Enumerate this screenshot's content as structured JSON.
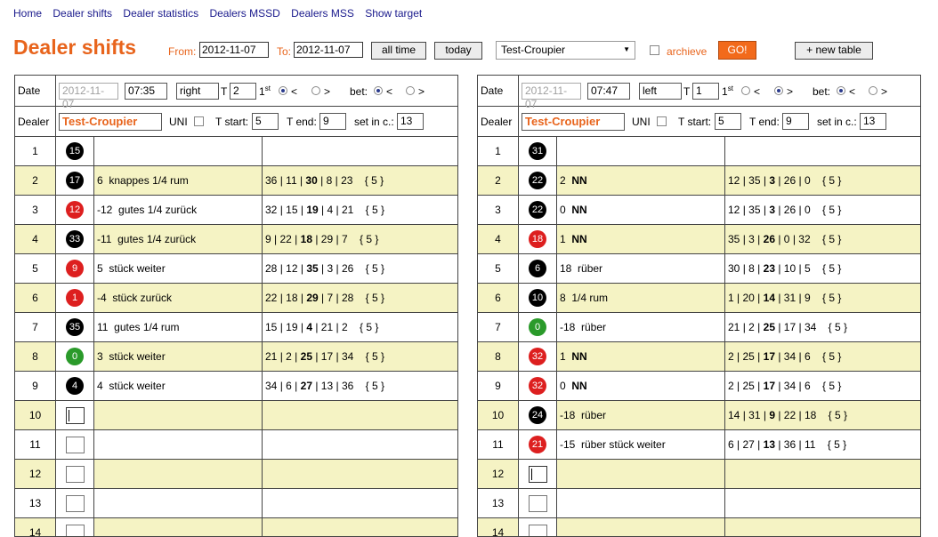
{
  "nav": [
    "Home",
    "Dealer shifts",
    "Dealer statistics",
    "Dealers MSSD",
    "Dealers MSS",
    "Show target"
  ],
  "page_title": "Dealer shifts",
  "filter": {
    "from_label": "From:",
    "from_value": "2012-11-07",
    "to_label": "To:",
    "to_value": "2012-11-07",
    "all_time": "all time",
    "today": "today",
    "croupier": "Test-Croupier",
    "archieve": "archieve",
    "go": "GO!",
    "new_table": "+ new table"
  },
  "labels": {
    "date": "Date",
    "dealer": "Dealer",
    "t": "T",
    "bet": "bet:",
    "uni": "UNI",
    "t_start": "T start:",
    "t_end": "T end:",
    "set_in_c": "set in c.:",
    "lt": "<",
    "gt": ">",
    "st_base": "1",
    "st_sup": "st"
  },
  "tables": [
    {
      "date": "2012-11-07",
      "time": "07:35",
      "side": "right",
      "t_value": "2",
      "st_choice": "<",
      "bet_choice": "<",
      "dealer": "Test-Croupier",
      "t_start": "5",
      "t_end": "9",
      "set_in": "13",
      "rows": [
        {
          "num": "1",
          "ball": "15",
          "color": "black",
          "move_n": "",
          "move_text": "",
          "seq": []
        },
        {
          "num": "2",
          "ball": "17",
          "color": "black",
          "move_n": "6",
          "move_text": "knappes 1/4 rum",
          "seq": [
            "36",
            "11",
            "30",
            "8",
            "23"
          ],
          "bold": 2,
          "tail": "{ 5 }"
        },
        {
          "num": "3",
          "ball": "12",
          "color": "red",
          "move_n": "-12",
          "move_text": "gutes 1/4 zurück",
          "seq": [
            "32",
            "15",
            "19",
            "4",
            "21"
          ],
          "bold": 2,
          "tail": "{ 5 }"
        },
        {
          "num": "4",
          "ball": "33",
          "color": "black",
          "move_n": "-11",
          "move_text": "gutes 1/4 zurück",
          "seq": [
            "9",
            "22",
            "18",
            "29",
            "7"
          ],
          "bold": 2,
          "tail": "{ 5 }"
        },
        {
          "num": "5",
          "ball": "9",
          "color": "red",
          "move_n": "5",
          "move_text": "stück weiter",
          "seq": [
            "28",
            "12",
            "35",
            "3",
            "26"
          ],
          "bold": 2,
          "tail": "{ 5 }"
        },
        {
          "num": "6",
          "ball": "1",
          "color": "red",
          "move_n": "-4",
          "move_text": "stück zurück",
          "seq": [
            "22",
            "18",
            "29",
            "7",
            "28"
          ],
          "bold": 2,
          "tail": "{ 5 }"
        },
        {
          "num": "7",
          "ball": "35",
          "color": "black",
          "move_n": "11",
          "move_text": "gutes 1/4 rum",
          "seq": [
            "15",
            "19",
            "4",
            "21",
            "2"
          ],
          "bold": 2,
          "tail": "{ 5 }"
        },
        {
          "num": "8",
          "ball": "0",
          "color": "green",
          "move_n": "3",
          "move_text": "stück weiter",
          "seq": [
            "21",
            "2",
            "25",
            "17",
            "34"
          ],
          "bold": 2,
          "tail": "{ 5 }"
        },
        {
          "num": "9",
          "ball": "4",
          "color": "black",
          "move_n": "4",
          "move_text": "stück weiter",
          "seq": [
            "34",
            "6",
            "27",
            "13",
            "36"
          ],
          "bold": 2,
          "tail": "{ 5 }"
        },
        {
          "num": "10",
          "ball": "",
          "color": "empty-focus",
          "move_n": "",
          "move_text": "",
          "seq": []
        },
        {
          "num": "11",
          "ball": "",
          "color": "empty",
          "move_n": "",
          "move_text": "",
          "seq": []
        },
        {
          "num": "12",
          "ball": "",
          "color": "empty",
          "move_n": "",
          "move_text": "",
          "seq": []
        },
        {
          "num": "13",
          "ball": "",
          "color": "empty",
          "move_n": "",
          "move_text": "",
          "seq": []
        },
        {
          "num": "14",
          "ball": "",
          "color": "empty",
          "move_n": "",
          "move_text": "",
          "seq": []
        }
      ]
    },
    {
      "date": "2012-11-07",
      "time": "07:47",
      "side": "left",
      "t_value": "1",
      "st_choice": ">",
      "bet_choice": "<",
      "dealer": "Test-Croupier",
      "t_start": "5",
      "t_end": "9",
      "set_in": "13",
      "rows": [
        {
          "num": "1",
          "ball": "31",
          "color": "black",
          "move_n": "",
          "move_text": "",
          "seq": []
        },
        {
          "num": "2",
          "ball": "22",
          "color": "black",
          "move_n": "2",
          "move_text": "NN",
          "move_bold": true,
          "seq": [
            "12",
            "35",
            "3",
            "26",
            "0"
          ],
          "bold": 2,
          "tail": "{ 5 }"
        },
        {
          "num": "3",
          "ball": "22",
          "color": "black",
          "move_n": "0",
          "move_text": "NN",
          "move_bold": true,
          "seq": [
            "12",
            "35",
            "3",
            "26",
            "0"
          ],
          "bold": 2,
          "tail": "{ 5 }"
        },
        {
          "num": "4",
          "ball": "18",
          "color": "red",
          "move_n": "1",
          "move_text": "NN",
          "move_bold": true,
          "seq": [
            "35",
            "3",
            "26",
            "0",
            "32"
          ],
          "bold": 2,
          "tail": "{ 5 }"
        },
        {
          "num": "5",
          "ball": "6",
          "color": "black",
          "move_n": "18",
          "move_text": "rüber",
          "seq": [
            "30",
            "8",
            "23",
            "10",
            "5"
          ],
          "bold": 2,
          "tail": "{ 5 }"
        },
        {
          "num": "6",
          "ball": "10",
          "color": "black",
          "move_n": "8",
          "move_text": "1/4 rum",
          "seq": [
            "1",
            "20",
            "14",
            "31",
            "9"
          ],
          "bold": 2,
          "tail": "{ 5 }"
        },
        {
          "num": "7",
          "ball": "0",
          "color": "green",
          "move_n": "-18",
          "move_text": "rüber",
          "seq": [
            "21",
            "2",
            "25",
            "17",
            "34"
          ],
          "bold": 2,
          "tail": "{ 5 }"
        },
        {
          "num": "8",
          "ball": "32",
          "color": "red",
          "move_n": "1",
          "move_text": "NN",
          "move_bold": true,
          "seq": [
            "2",
            "25",
            "17",
            "34",
            "6"
          ],
          "bold": 2,
          "tail": "{ 5 }"
        },
        {
          "num": "9",
          "ball": "32",
          "color": "red",
          "move_n": "0",
          "move_text": "NN",
          "move_bold": true,
          "seq": [
            "2",
            "25",
            "17",
            "34",
            "6"
          ],
          "bold": 2,
          "tail": "{ 5 }"
        },
        {
          "num": "10",
          "ball": "24",
          "color": "black",
          "move_n": "-18",
          "move_text": "rüber",
          "seq": [
            "14",
            "31",
            "9",
            "22",
            "18"
          ],
          "bold": 2,
          "tail": "{ 5 }"
        },
        {
          "num": "11",
          "ball": "21",
          "color": "red",
          "move_n": "-15",
          "move_text": "rüber stück weiter",
          "seq": [
            "6",
            "27",
            "13",
            "36",
            "11"
          ],
          "bold": 2,
          "tail": "{ 5 }"
        },
        {
          "num": "12",
          "ball": "",
          "color": "empty-focus",
          "move_n": "",
          "move_text": "",
          "seq": []
        },
        {
          "num": "13",
          "ball": "",
          "color": "empty",
          "move_n": "",
          "move_text": "",
          "seq": []
        },
        {
          "num": "14",
          "ball": "",
          "color": "empty",
          "move_n": "",
          "move_text": "",
          "seq": []
        }
      ]
    }
  ],
  "colors": {
    "accent": "#e8641c",
    "go_button": "#f26a1b",
    "row_highlight": "#f5f3c4",
    "ball_black": "#000000",
    "ball_red": "#dd1f1f",
    "ball_green": "#2a9a2a",
    "link": "#1a1a8c"
  },
  "icons": [
    "select-arrow-icon",
    "checkbox-icon",
    "radio-icon"
  ]
}
